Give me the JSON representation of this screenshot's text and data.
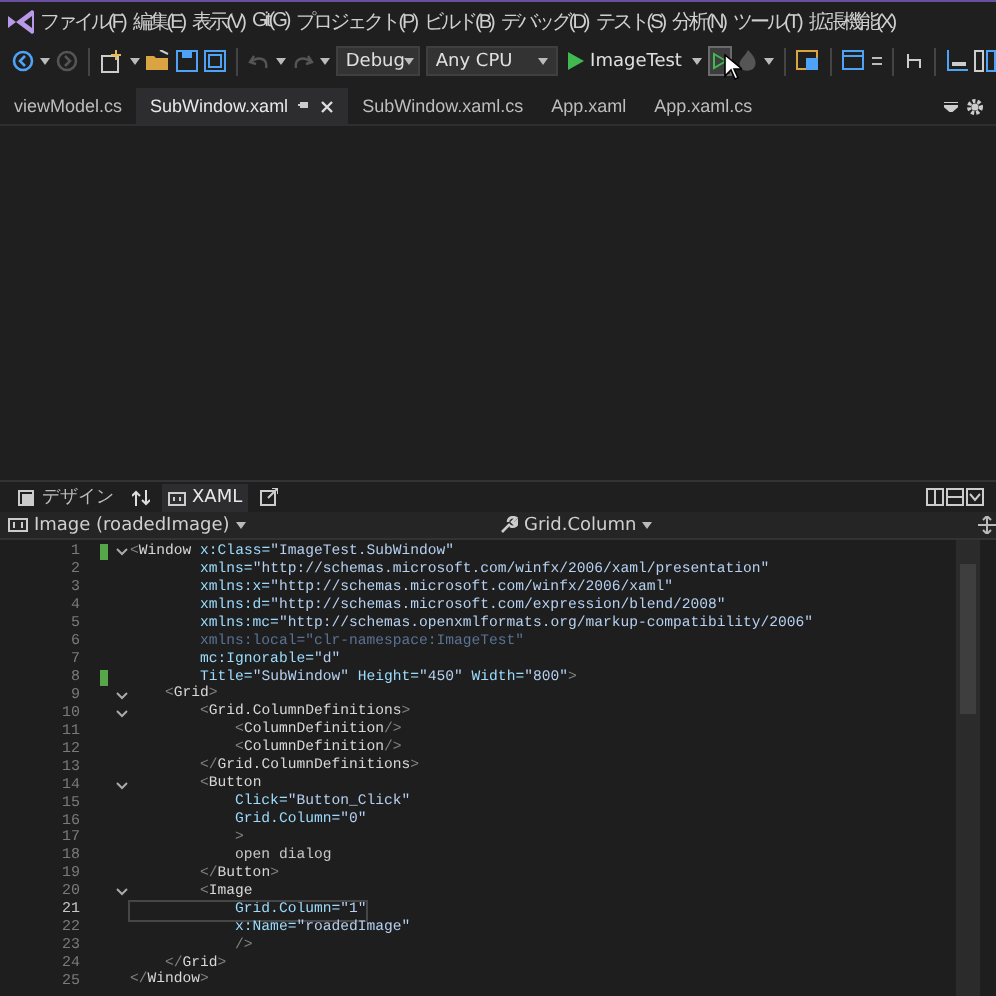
{
  "menu": [
    "ファイル(F)",
    "編集(E)",
    "表示(V)",
    "Git(G)",
    "プロジェクト(P)",
    "ビルド(B)",
    "デバッグ(D)",
    "テスト(S)",
    "分析(N)",
    "ツール(T)",
    "拡張機能(X)"
  ],
  "toolbar": {
    "configuration": "Debug",
    "platform": "Any CPU",
    "start": "ImageTest"
  },
  "tabs": [
    {
      "label": "viewModel.cs",
      "selected": false
    },
    {
      "label": "SubWindow.xaml",
      "selected": true
    },
    {
      "label": "SubWindow.xaml.cs",
      "selected": false
    },
    {
      "label": "App.xaml",
      "selected": false
    },
    {
      "label": "App.xaml.cs",
      "selected": false
    }
  ],
  "view_tabs": [
    {
      "label": "デザイン",
      "selected": false
    },
    {
      "label": "XAML",
      "selected": true
    }
  ],
  "nav": {
    "element": "Image (roadedImage)",
    "member": "Grid.Column"
  },
  "code_lines": [
    {
      "number": "1",
      "foldable": true,
      "changed": true,
      "current": false,
      "segments": [
        {
          "kind": "punct",
          "text": "<"
        },
        {
          "kind": "tag",
          "text": "Window"
        },
        {
          "kind": "attr",
          "text": " x:Class="
        },
        {
          "kind": "value",
          "text": "\"ImageTest.SubWindow\""
        }
      ]
    },
    {
      "number": "2",
      "foldable": false,
      "changed": false,
      "current": false,
      "segments": [
        {
          "kind": "attr",
          "text": "        xmlns="
        },
        {
          "kind": "value",
          "text": "\"http://schemas.microsoft.com/winfx/2006/xaml/presentation\""
        }
      ]
    },
    {
      "number": "3",
      "foldable": false,
      "changed": false,
      "current": false,
      "segments": [
        {
          "kind": "attr",
          "text": "        xmlns:x="
        },
        {
          "kind": "value",
          "text": "\"http://schemas.microsoft.com/winfx/2006/xaml\""
        }
      ]
    },
    {
      "number": "4",
      "foldable": false,
      "changed": false,
      "current": false,
      "segments": [
        {
          "kind": "attr",
          "text": "        xmlns:d="
        },
        {
          "kind": "value",
          "text": "\"http://schemas.microsoft.com/expression/blend/2008\""
        }
      ]
    },
    {
      "number": "5",
      "foldable": false,
      "changed": false,
      "current": false,
      "segments": [
        {
          "kind": "attr",
          "text": "        xmlns:mc="
        },
        {
          "kind": "value",
          "text": "\"http://schemas.openxmlformats.org/markup-compatibility/2006\""
        }
      ]
    },
    {
      "number": "6",
      "foldable": false,
      "changed": false,
      "current": false,
      "segments": [
        {
          "kind": "dim",
          "text": "        xmlns:local=\"clr-namespace:ImageTest\""
        }
      ]
    },
    {
      "number": "7",
      "foldable": false,
      "changed": false,
      "current": false,
      "segments": [
        {
          "kind": "attr",
          "text": "        mc:Ignorable="
        },
        {
          "kind": "value",
          "text": "\"d\""
        }
      ]
    },
    {
      "number": "8",
      "foldable": false,
      "changed": true,
      "current": false,
      "segments": [
        {
          "kind": "attr",
          "text": "        Title="
        },
        {
          "kind": "value",
          "text": "\"SubWindow\""
        },
        {
          "kind": "attr",
          "text": " Height="
        },
        {
          "kind": "value",
          "text": "\"450\""
        },
        {
          "kind": "attr",
          "text": " Width="
        },
        {
          "kind": "value",
          "text": "\"800\""
        },
        {
          "kind": "punct",
          "text": ">"
        }
      ]
    },
    {
      "number": "9",
      "foldable": true,
      "changed": false,
      "current": false,
      "segments": [
        {
          "kind": "punct",
          "text": "    <"
        },
        {
          "kind": "tag",
          "text": "Grid"
        },
        {
          "kind": "punct",
          "text": ">"
        }
      ]
    },
    {
      "number": "10",
      "foldable": true,
      "changed": false,
      "current": false,
      "segments": [
        {
          "kind": "punct",
          "text": "        <"
        },
        {
          "kind": "tag",
          "text": "Grid.ColumnDefinitions"
        },
        {
          "kind": "punct",
          "text": ">"
        }
      ]
    },
    {
      "number": "11",
      "foldable": false,
      "changed": false,
      "current": false,
      "segments": [
        {
          "kind": "punct",
          "text": "            <"
        },
        {
          "kind": "tag",
          "text": "ColumnDefinition"
        },
        {
          "kind": "punct",
          "text": "/>"
        }
      ]
    },
    {
      "number": "12",
      "foldable": false,
      "changed": false,
      "current": false,
      "segments": [
        {
          "kind": "punct",
          "text": "            <"
        },
        {
          "kind": "tag",
          "text": "ColumnDefinition"
        },
        {
          "kind": "punct",
          "text": "/>"
        }
      ]
    },
    {
      "number": "13",
      "foldable": false,
      "changed": false,
      "current": false,
      "segments": [
        {
          "kind": "punct",
          "text": "        </"
        },
        {
          "kind": "tag",
          "text": "Grid.ColumnDefinitions"
        },
        {
          "kind": "punct",
          "text": ">"
        }
      ]
    },
    {
      "number": "14",
      "foldable": true,
      "changed": false,
      "current": false,
      "segments": [
        {
          "kind": "punct",
          "text": "        <"
        },
        {
          "kind": "tag",
          "text": "Button"
        }
      ]
    },
    {
      "number": "15",
      "foldable": false,
      "changed": false,
      "current": false,
      "segments": [
        {
          "kind": "attr",
          "text": "            Click="
        },
        {
          "kind": "value",
          "text": "\"Button_Click\""
        }
      ]
    },
    {
      "number": "16",
      "foldable": false,
      "changed": false,
      "current": false,
      "segments": [
        {
          "kind": "attr",
          "text": "            Grid.Column="
        },
        {
          "kind": "value",
          "text": "\"0\""
        }
      ]
    },
    {
      "number": "17",
      "foldable": false,
      "changed": false,
      "current": false,
      "segments": [
        {
          "kind": "punct",
          "text": "            >"
        }
      ]
    },
    {
      "number": "18",
      "foldable": false,
      "changed": false,
      "current": false,
      "segments": [
        {
          "kind": "text",
          "text": "            open dialog"
        }
      ]
    },
    {
      "number": "19",
      "foldable": false,
      "changed": false,
      "current": false,
      "segments": [
        {
          "kind": "punct",
          "text": "        </"
        },
        {
          "kind": "tag",
          "text": "Button"
        },
        {
          "kind": "punct",
          "text": ">"
        }
      ]
    },
    {
      "number": "20",
      "foldable": true,
      "changed": false,
      "current": false,
      "segments": [
        {
          "kind": "punct",
          "text": "        <"
        },
        {
          "kind": "tag",
          "text": "Image"
        }
      ]
    },
    {
      "number": "21",
      "foldable": false,
      "changed": false,
      "current": true,
      "segments": [
        {
          "kind": "attr",
          "text": "            Grid.Column="
        },
        {
          "kind": "value",
          "text": "\"1\""
        }
      ]
    },
    {
      "number": "22",
      "foldable": false,
      "changed": false,
      "current": false,
      "segments": [
        {
          "kind": "attr",
          "text": "            x:Name="
        },
        {
          "kind": "value",
          "text": "\"roadedImage\""
        }
      ]
    },
    {
      "number": "23",
      "foldable": false,
      "changed": false,
      "current": false,
      "segments": [
        {
          "kind": "punct",
          "text": "            />"
        }
      ]
    },
    {
      "number": "24",
      "foldable": false,
      "changed": false,
      "current": false,
      "segments": [
        {
          "kind": "punct",
          "text": "    </"
        },
        {
          "kind": "tag",
          "text": "Grid"
        },
        {
          "kind": "punct",
          "text": ">"
        }
      ]
    },
    {
      "number": "25",
      "foldable": false,
      "changed": false,
      "current": false,
      "segments": [
        {
          "kind": "punct",
          "text": "</"
        },
        {
          "kind": "tag",
          "text": "Window"
        },
        {
          "kind": "punct",
          "text": ">"
        }
      ]
    }
  ]
}
